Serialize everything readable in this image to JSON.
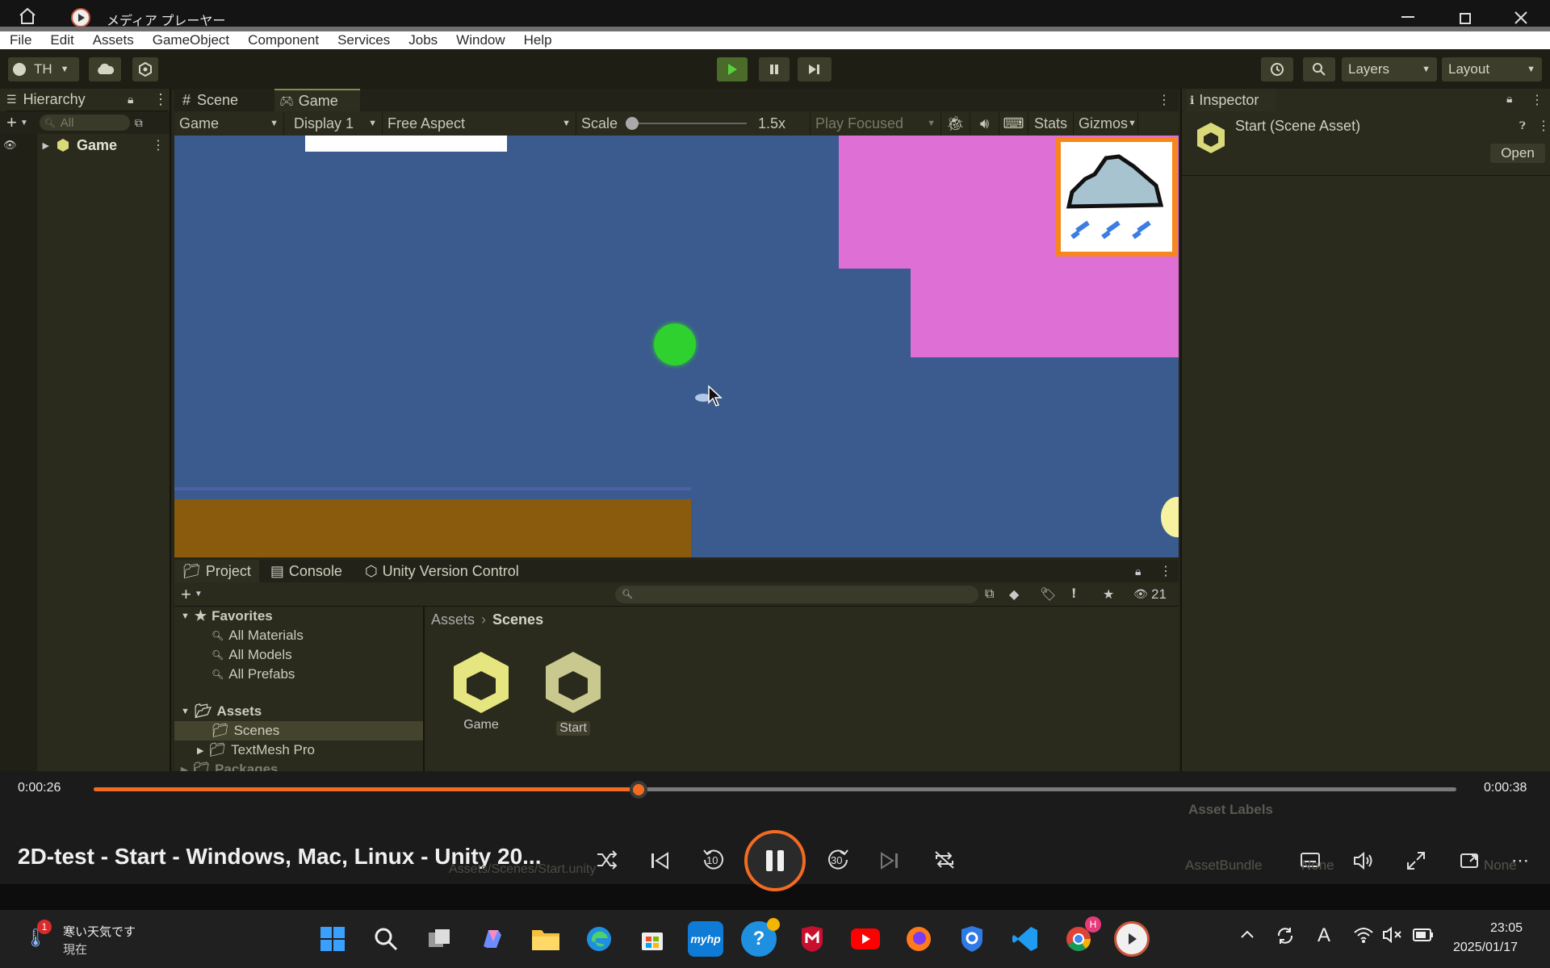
{
  "window": {
    "title": "メディア プレーヤー"
  },
  "menu": [
    "File",
    "Edit",
    "Assets",
    "GameObject",
    "Component",
    "Services",
    "Jobs",
    "Window",
    "Help"
  ],
  "toolbar": {
    "account": "TH",
    "layers": "Layers",
    "layout": "Layout"
  },
  "hierarchy": {
    "tab": "Hierarchy",
    "search_placeholder": "All",
    "scene": "Game"
  },
  "viewtabs": {
    "scene": "Scene",
    "game": "Game"
  },
  "gamebar": {
    "mode": "Game",
    "display": "Display 1",
    "aspect": "Free Aspect",
    "scale_label": "Scale",
    "scale_value": "1.5x",
    "play_focused": "Play Focused",
    "stats": "Stats",
    "gizmos": "Gizmos"
  },
  "inspector": {
    "tab": "Inspector",
    "title": "Start (Scene Asset)",
    "open": "Open",
    "asset_labels": "Asset Labels",
    "assetbundle": "AssetBundle",
    "none1": "None",
    "none2": "None"
  },
  "project": {
    "tabs": [
      "Project",
      "Console",
      "Unity Version Control"
    ],
    "hidden_count": "21",
    "favorites": "Favorites",
    "favorite_items": [
      "All Materials",
      "All Models",
      "All Prefabs"
    ],
    "assets": "Assets",
    "asset_folders": [
      "Scenes",
      "TextMesh Pro"
    ],
    "packages": "Packages",
    "breadcrumb": [
      "Assets",
      "Scenes"
    ],
    "files": [
      "Game",
      "Start"
    ],
    "path": "Assets/Scenes/Start.unity"
  },
  "media": {
    "elapsed": "0:00:26",
    "duration": "0:00:38",
    "progress": 0.4,
    "title": "2D-test - Start - Windows, Mac, Linux - Unity 20...",
    "skip_back": "10",
    "skip_forward": "30"
  },
  "taskbar": {
    "weather_text": "寒い天気です",
    "weather_sub": "現在",
    "weather_badge": "1",
    "time": "23:05",
    "date": "2025/01/17",
    "chrome_badge": "H"
  },
  "colors": {
    "accent": "#f26b21",
    "unity_bg": "#262619",
    "game_sky": "#3b5b8e",
    "pink": "#de6fd5",
    "ground": "#8a5b0c"
  }
}
